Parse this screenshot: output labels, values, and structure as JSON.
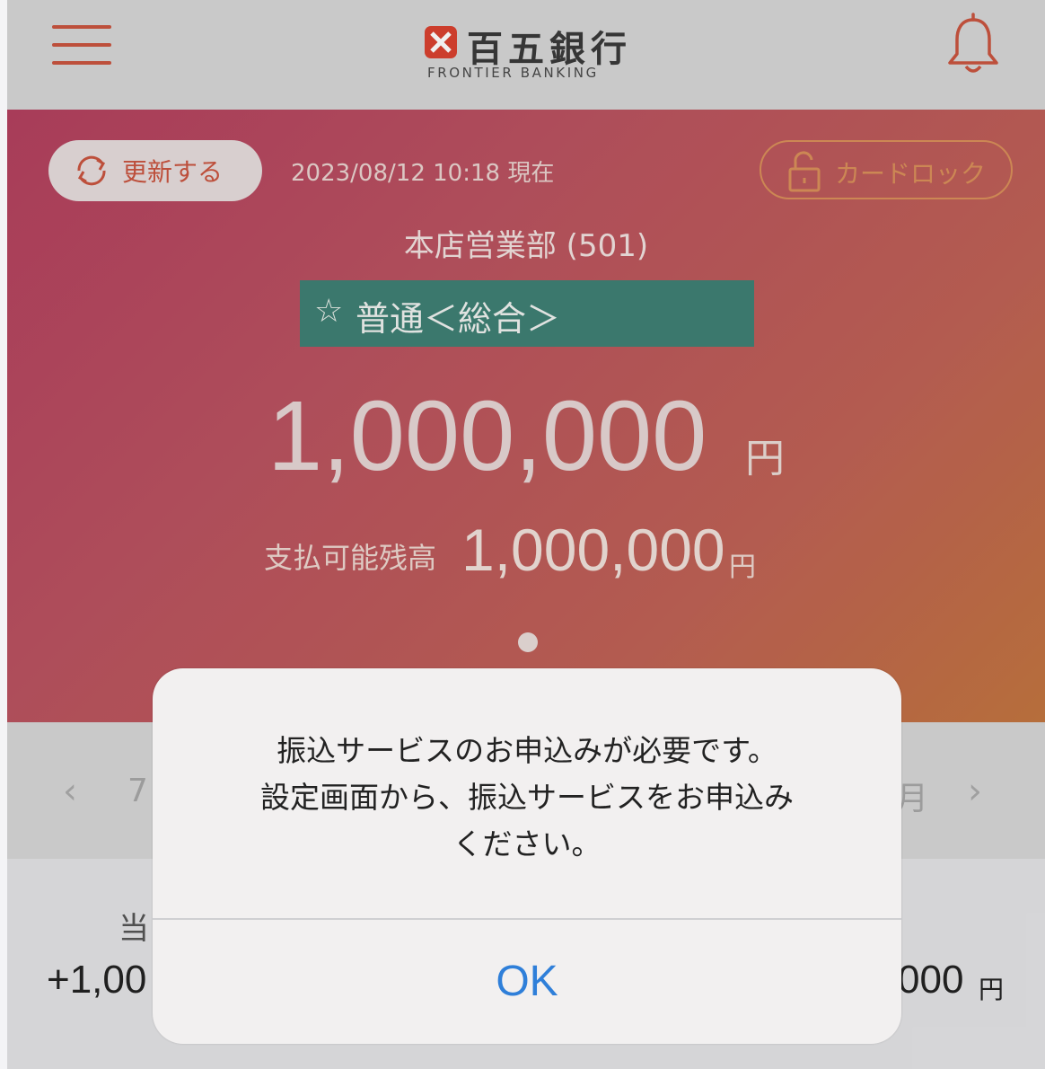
{
  "header": {
    "bank_name": "百五銀行",
    "bank_subtitle": "FRONTIER BANKING",
    "menu_icon": "hamburger-menu-icon",
    "notification_icon": "bell-icon",
    "brand_color": "#c9543f"
  },
  "account": {
    "refresh_label": "更新する",
    "timestamp": "2023/08/12 10:18 現在",
    "card_lock_label": "カードロック",
    "branch": "本店営業部 (501)",
    "account_type": "普通＜総合＞",
    "favorite_icon": "☆",
    "balance": "1,000,000",
    "balance_unit": "円",
    "available_label": "支払可能残高",
    "available_value": "1,000,000",
    "available_unit": "円",
    "accent_color": "#3f8074"
  },
  "month_nav": {
    "prev_icon": "‹",
    "next_icon": "›",
    "left_partial": "7",
    "right_partial": "月"
  },
  "summary": {
    "label_partial": "当",
    "left_value_partial": "+1,00",
    "right_value_partial": "000",
    "unit": "円"
  },
  "dialog": {
    "message_lines": [
      "振込サービスのお申込みが必要です。",
      "設定画面から、振込サービスをお申込み",
      "ください。"
    ],
    "ok_label": "OK",
    "ok_color": "#2f7fd9"
  }
}
